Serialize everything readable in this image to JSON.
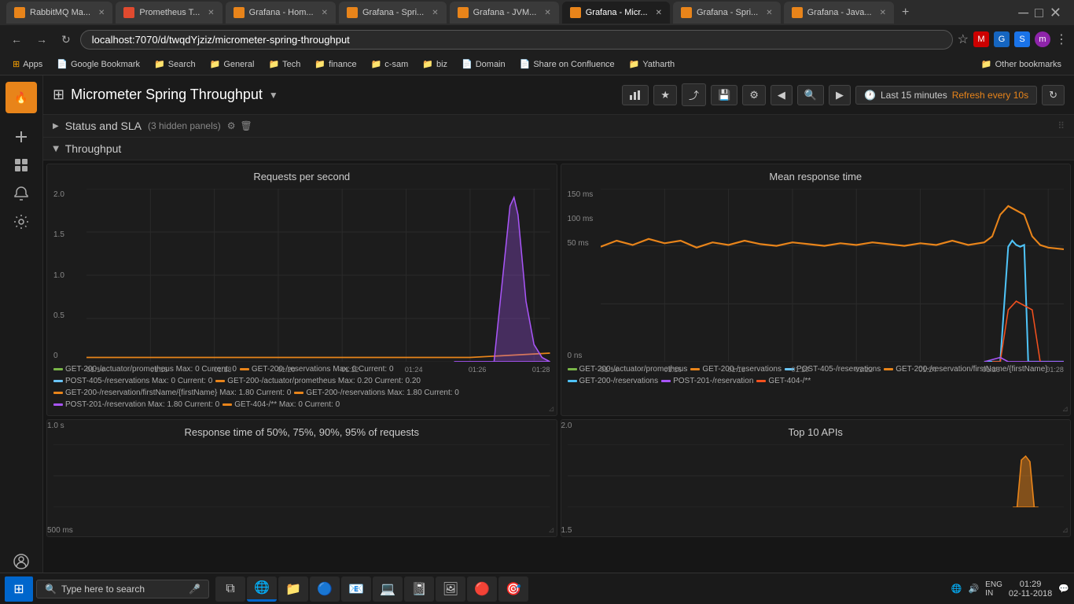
{
  "browser": {
    "tabs": [
      {
        "id": "rabbitmq",
        "label": "RabbitMQ Ma...",
        "favicon_color": "#e8841a",
        "active": false
      },
      {
        "id": "prometheus",
        "label": "Prometheus T...",
        "favicon_color": "#e04a2f",
        "active": false
      },
      {
        "id": "grafana-home",
        "label": "Grafana - Hom...",
        "favicon_color": "#e8841a",
        "active": false
      },
      {
        "id": "grafana-spring",
        "label": "Grafana - Spri...",
        "favicon_color": "#e8841a",
        "active": false
      },
      {
        "id": "grafana-jvm",
        "label": "Grafana - JVM...",
        "favicon_color": "#e8841a",
        "active": false
      },
      {
        "id": "grafana-micro",
        "label": "Grafana - Micr...",
        "favicon_color": "#e8841a",
        "active": true
      },
      {
        "id": "grafana-sp2",
        "label": "Grafana - Spri...",
        "favicon_color": "#e8841a",
        "active": false
      },
      {
        "id": "grafana-java",
        "label": "Grafana - Java...",
        "favicon_color": "#e8841a",
        "active": false
      }
    ],
    "url": "localhost:7070/d/twqdYjziz/micrometer-spring-throughput",
    "bookmarks": [
      {
        "id": "apps",
        "label": "Apps",
        "type": "folder"
      },
      {
        "id": "google-bookmark",
        "label": "Google Bookmark",
        "type": "folder"
      },
      {
        "id": "search",
        "label": "Search",
        "type": "folder"
      },
      {
        "id": "general",
        "label": "General",
        "type": "folder"
      },
      {
        "id": "tech",
        "label": "Tech",
        "type": "folder"
      },
      {
        "id": "finance",
        "label": "finance",
        "type": "folder"
      },
      {
        "id": "c-sam",
        "label": "c-sam",
        "type": "folder"
      },
      {
        "id": "biz",
        "label": "biz",
        "type": "folder"
      },
      {
        "id": "domain",
        "label": "Domain",
        "type": "link"
      },
      {
        "id": "share-confluence",
        "label": "Share on Confluence",
        "type": "link"
      },
      {
        "id": "yatharth",
        "label": "Yatharth",
        "type": "folder"
      },
      {
        "id": "other",
        "label": "Other bookmarks",
        "type": "folder"
      }
    ]
  },
  "grafana": {
    "sidebar_logo": "🔥",
    "dashboard_title": "Micrometer Spring Throughput",
    "status_section": {
      "title": "Status and SLA",
      "meta": "(3 hidden panels)"
    },
    "throughput_section": {
      "title": "Throughput"
    },
    "time_range": "Last 15 minutes",
    "refresh": "Refresh every 10s",
    "panels": [
      {
        "id": "requests-per-second",
        "title": "Requests per second",
        "y_labels": [
          "2.0",
          "1.5",
          "1.0",
          "0.5",
          "0"
        ],
        "x_labels": [
          "01:14",
          "01:16",
          "01:18",
          "01:20",
          "01:22",
          "01:24",
          "01:26",
          "01:28"
        ],
        "legend": [
          {
            "label": "GET-200-/actuator/prometheus  Max: 0  Current: 0",
            "color": "#7ab648"
          },
          {
            "label": "GET-200-/reservations  Max: 0  Current: 0",
            "color": "#e8841a"
          },
          {
            "label": "POST-405-/reservations  Max: 0  Current: 0",
            "color": "#6bc5f8"
          },
          {
            "label": "GET-200-/actuator/prometheus  Max: 0.20  Current: 0.20",
            "color": "#e8841a"
          },
          {
            "label": "GET-200-/reservation/firstName/{firstName}  Max: 1.80  Current: 0",
            "color": "#e8841a"
          },
          {
            "label": "GET-200-/reservations  Max: 1.80  Current: 0",
            "color": "#e8841a"
          },
          {
            "label": "POST-201-/reservation  Max: 1.80  Current: 0",
            "color": "#a855f7"
          },
          {
            "label": "GET-404-/**  Max: 0  Current: 0",
            "color": "#e8841a"
          }
        ]
      },
      {
        "id": "mean-response-time",
        "title": "Mean response time",
        "y_labels": [
          "150 ms",
          "100 ms",
          "50 ms",
          "0 ns"
        ],
        "x_labels": [
          "01:14",
          "01:16",
          "01:18",
          "01:20",
          "01:22",
          "01:24",
          "01:26",
          "01:28"
        ],
        "legend": [
          {
            "label": "GET-200-/actuator/prometheus",
            "color": "#7ab648"
          },
          {
            "label": "GET-200-/reservations",
            "color": "#e8841a"
          },
          {
            "label": "POST-405-/reservations",
            "color": "#6bc5f8"
          },
          {
            "label": "GET-200-/reservation/firstName/{firstName}",
            "color": "#e8841a"
          },
          {
            "label": "GET-200-/reservations",
            "color": "#4fc3f7"
          },
          {
            "label": "POST-201-/reservation",
            "color": "#a855f7"
          },
          {
            "label": "GET-404-/**",
            "color": "#f4511e"
          }
        ]
      },
      {
        "id": "response-time-percentiles",
        "title": "Response time of 50%, 75%, 90%, 95% of requests",
        "y_labels": [
          "1.0 s",
          "500 ms"
        ],
        "x_labels": []
      },
      {
        "id": "top-10-apis",
        "title": "Top 10 APIs",
        "y_labels": [
          "2.0",
          "1.5"
        ],
        "x_labels": []
      }
    ]
  },
  "taskbar": {
    "search_placeholder": "Type here to search",
    "time": "01:29",
    "date": "02-11-2018",
    "lang": "ENG\nIN"
  }
}
